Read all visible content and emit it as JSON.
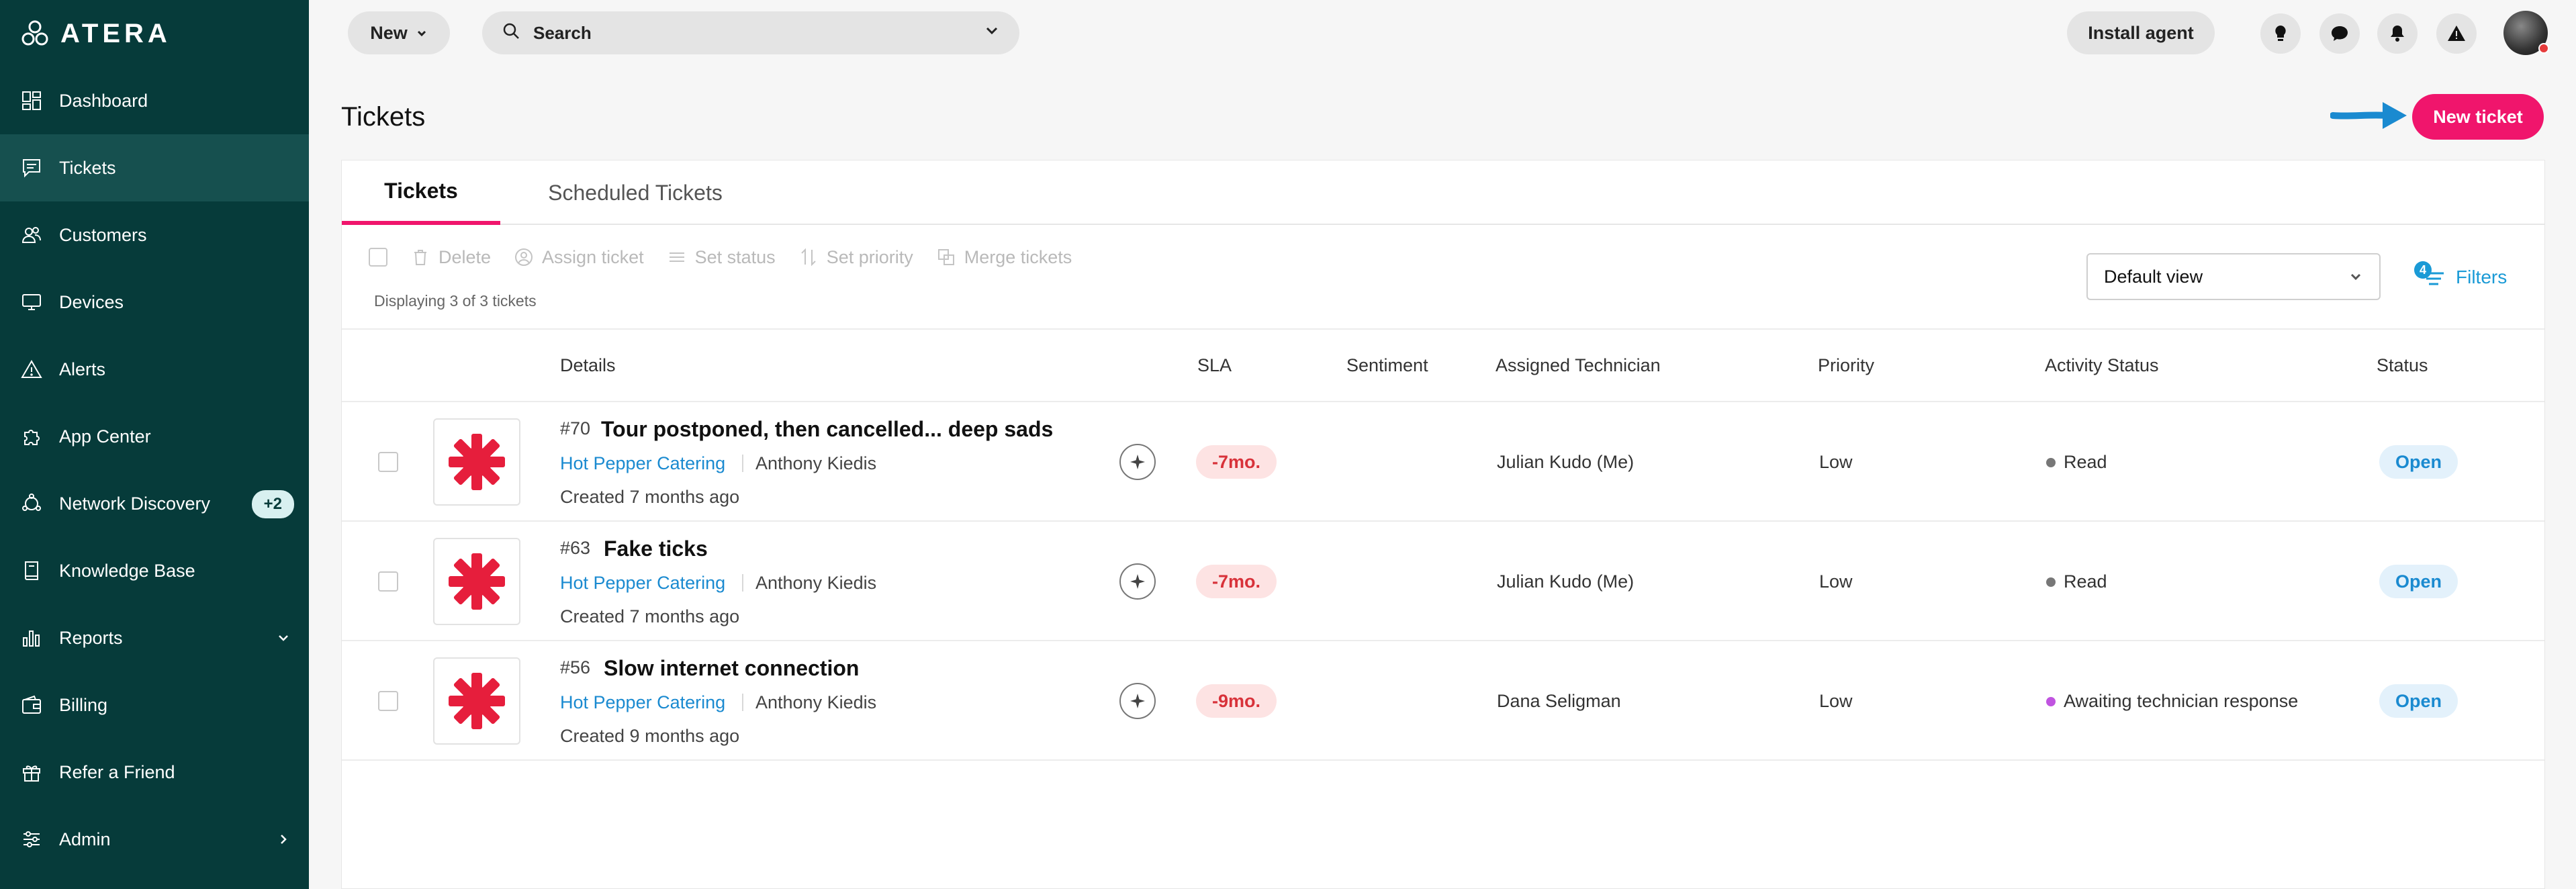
{
  "sidebar": {
    "logo": "ATERA",
    "items": [
      {
        "label": "Dashboard"
      },
      {
        "label": "Tickets"
      },
      {
        "label": "Customers"
      },
      {
        "label": "Devices"
      },
      {
        "label": "Alerts"
      },
      {
        "label": "App Center"
      },
      {
        "label": "Network Discovery",
        "badge": "+2"
      },
      {
        "label": "Knowledge Base"
      },
      {
        "label": "Reports"
      },
      {
        "label": "Billing"
      },
      {
        "label": "Refer a Friend"
      },
      {
        "label": "Admin"
      }
    ],
    "active_item": "Tickets"
  },
  "topbar": {
    "new_label": "New",
    "search_label": "Search",
    "install_label": "Install agent",
    "icons": [
      "lightbulb-icon",
      "chat-icon",
      "bell-icon",
      "warning-icon"
    ]
  },
  "page": {
    "title": "Tickets",
    "new_ticket_label": "New ticket"
  },
  "tabs": [
    {
      "label": "Tickets",
      "active": true
    },
    {
      "label": "Scheduled Tickets",
      "active": false
    }
  ],
  "bulk_actions": {
    "delete": "Delete",
    "assign": "Assign ticket",
    "set_status": "Set status",
    "set_priority": "Set priority",
    "merge": "Merge tickets"
  },
  "displaying": "Displaying 3 of 3 tickets",
  "view_select": "Default view",
  "filters": {
    "label": "Filters",
    "count": "4"
  },
  "table": {
    "headers": {
      "details": "Details",
      "sla": "SLA",
      "sentiment": "Sentiment",
      "technician": "Assigned Technician",
      "priority": "Priority",
      "activity": "Activity Status",
      "status": "Status"
    },
    "rows": [
      {
        "number": "#70",
        "title": "Tour postponed, then cancelled... deep sads",
        "customer": "Hot Pepper Catering",
        "contact": "Anthony Kiedis",
        "created": "Created 7 months ago",
        "sla": "-7mo.",
        "technician": "Julian Kudo (Me)",
        "priority": "Low",
        "activity": "Read",
        "activity_color": "#777777",
        "status": "Open"
      },
      {
        "number": "#63",
        "title": "Fake ticks",
        "customer": "Hot Pepper Catering",
        "contact": "Anthony Kiedis",
        "created": "Created 7 months ago",
        "sla": "-7mo.",
        "technician": "Julian Kudo (Me)",
        "priority": "Low",
        "activity": "Read",
        "activity_color": "#777777",
        "status": "Open"
      },
      {
        "number": "#56",
        "title": "Slow internet connection",
        "customer": "Hot Pepper Catering",
        "contact": "Anthony Kiedis",
        "created": "Created 9 months ago",
        "sla": "-9mo.",
        "technician": "Dana Seligman",
        "priority": "Low",
        "activity": "Awaiting technician response",
        "activity_color": "#c054e0",
        "status": "Open"
      }
    ]
  },
  "colors": {
    "sidebar_bg": "#063b3a",
    "accent_pink": "#f0156c",
    "link_blue": "#1a8ad0",
    "sla_red": "#d8323a"
  }
}
